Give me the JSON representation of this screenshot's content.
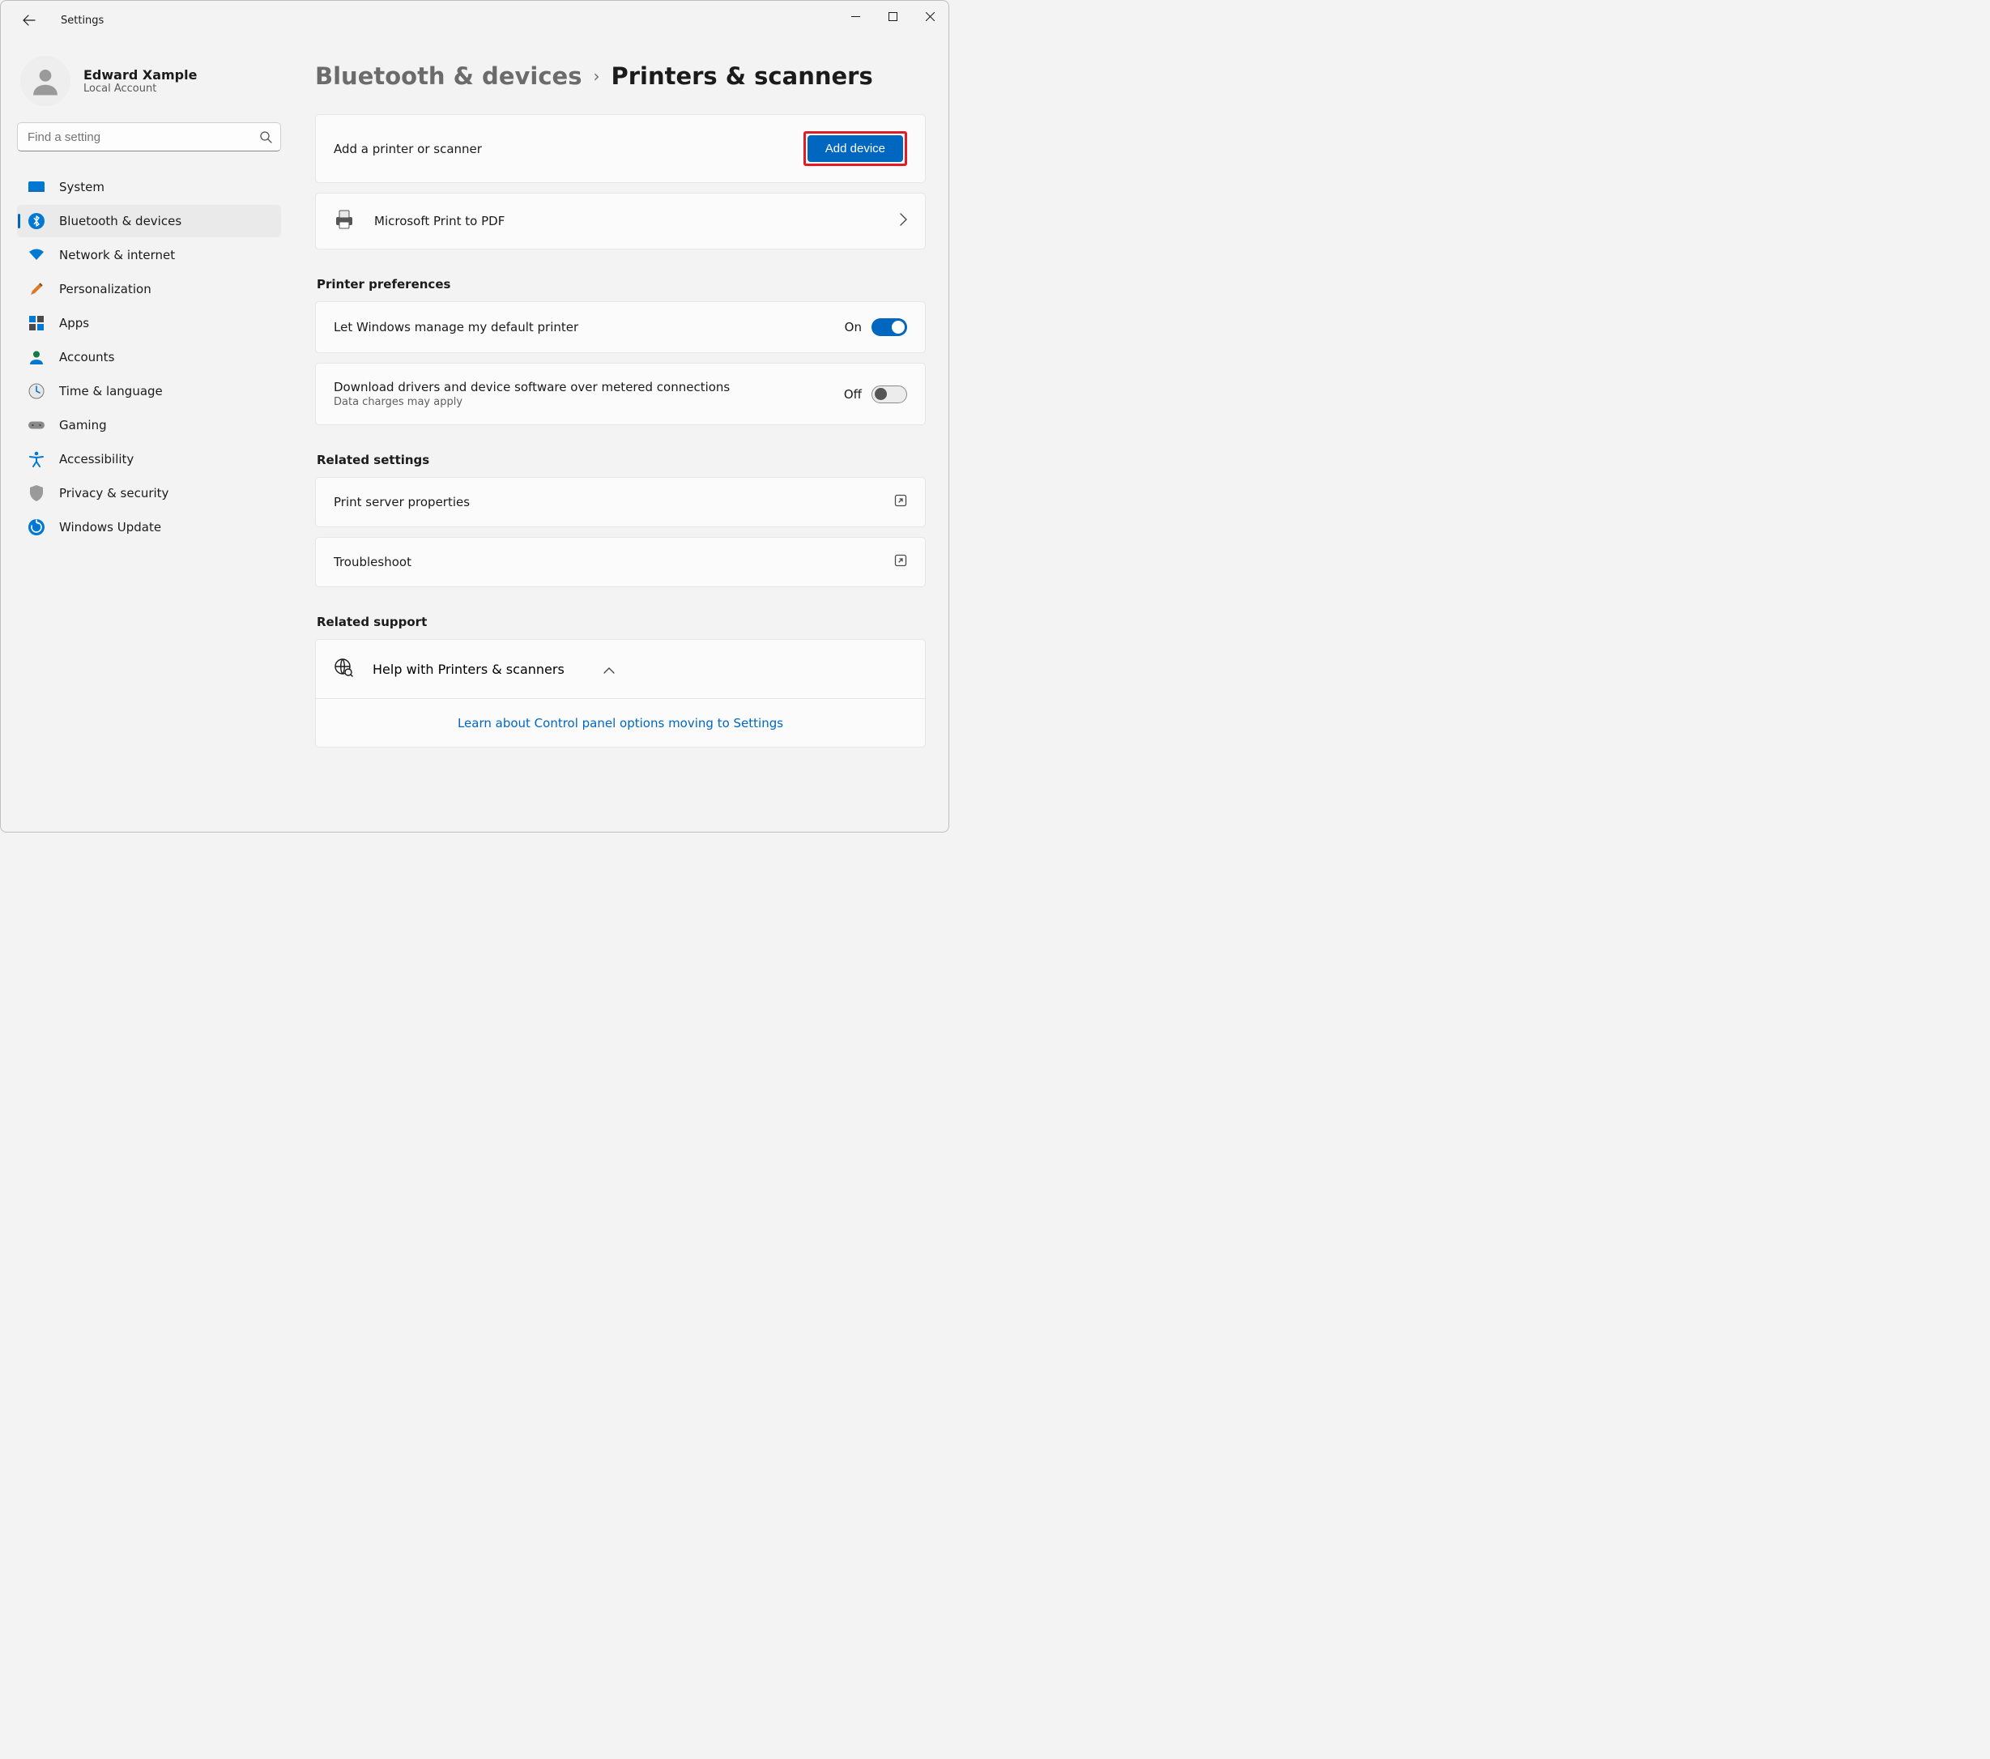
{
  "window": {
    "title": "Settings"
  },
  "account": {
    "name": "Edward Xample",
    "sub": "Local Account"
  },
  "search": {
    "placeholder": "Find a setting"
  },
  "nav": {
    "items": [
      {
        "label": "System"
      },
      {
        "label": "Bluetooth & devices"
      },
      {
        "label": "Network & internet"
      },
      {
        "label": "Personalization"
      },
      {
        "label": "Apps"
      },
      {
        "label": "Accounts"
      },
      {
        "label": "Time & language"
      },
      {
        "label": "Gaming"
      },
      {
        "label": "Accessibility"
      },
      {
        "label": "Privacy & security"
      },
      {
        "label": "Windows Update"
      }
    ]
  },
  "crumb": {
    "parent": "Bluetooth & devices",
    "current": "Printers & scanners"
  },
  "addRow": {
    "label": "Add a printer or scanner",
    "button": "Add device"
  },
  "printerRow": {
    "label": "Microsoft Print to PDF"
  },
  "prefs": {
    "heading": "Printer preferences",
    "rows": [
      {
        "label": "Let Windows manage my default printer",
        "state": "On",
        "on": true
      },
      {
        "label": "Download drivers and device software over metered connections",
        "sub": "Data charges may apply",
        "state": "Off",
        "on": false
      }
    ]
  },
  "related": {
    "heading": "Related settings",
    "rows": [
      {
        "label": "Print server properties"
      },
      {
        "label": "Troubleshoot"
      }
    ]
  },
  "support": {
    "heading": "Related support",
    "help": "Help with Printers & scanners",
    "link": "Learn about Control panel options moving to Settings"
  }
}
